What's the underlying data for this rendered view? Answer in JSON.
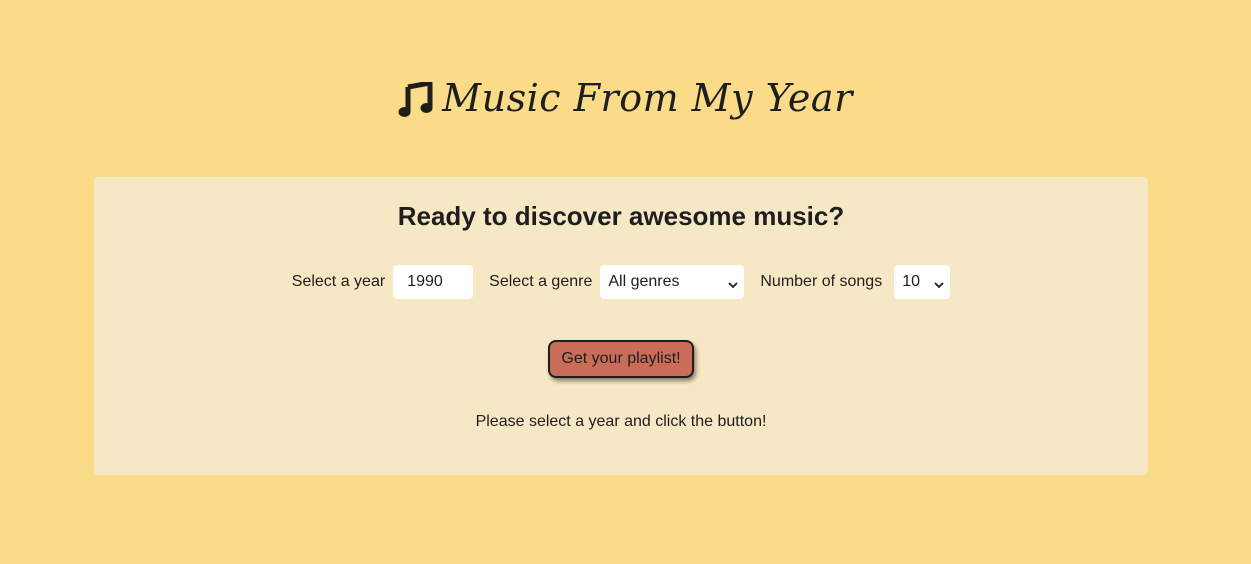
{
  "header": {
    "title": "Music From My Year",
    "icon": "music-note-icon"
  },
  "card": {
    "heading": "Ready to discover awesome music?",
    "year": {
      "label": "Select a year",
      "value": "1990"
    },
    "genre": {
      "label": "Select a genre",
      "selected": "All genres"
    },
    "songs": {
      "label": "Number of songs",
      "selected": "10"
    },
    "button_label": "Get your playlist!",
    "status": "Please select a year and click the button!"
  },
  "colors": {
    "page_background": "#fadb87",
    "card_background": "#f6e7c5",
    "button_background": "#c96c58",
    "text": "#1e1e1e"
  }
}
